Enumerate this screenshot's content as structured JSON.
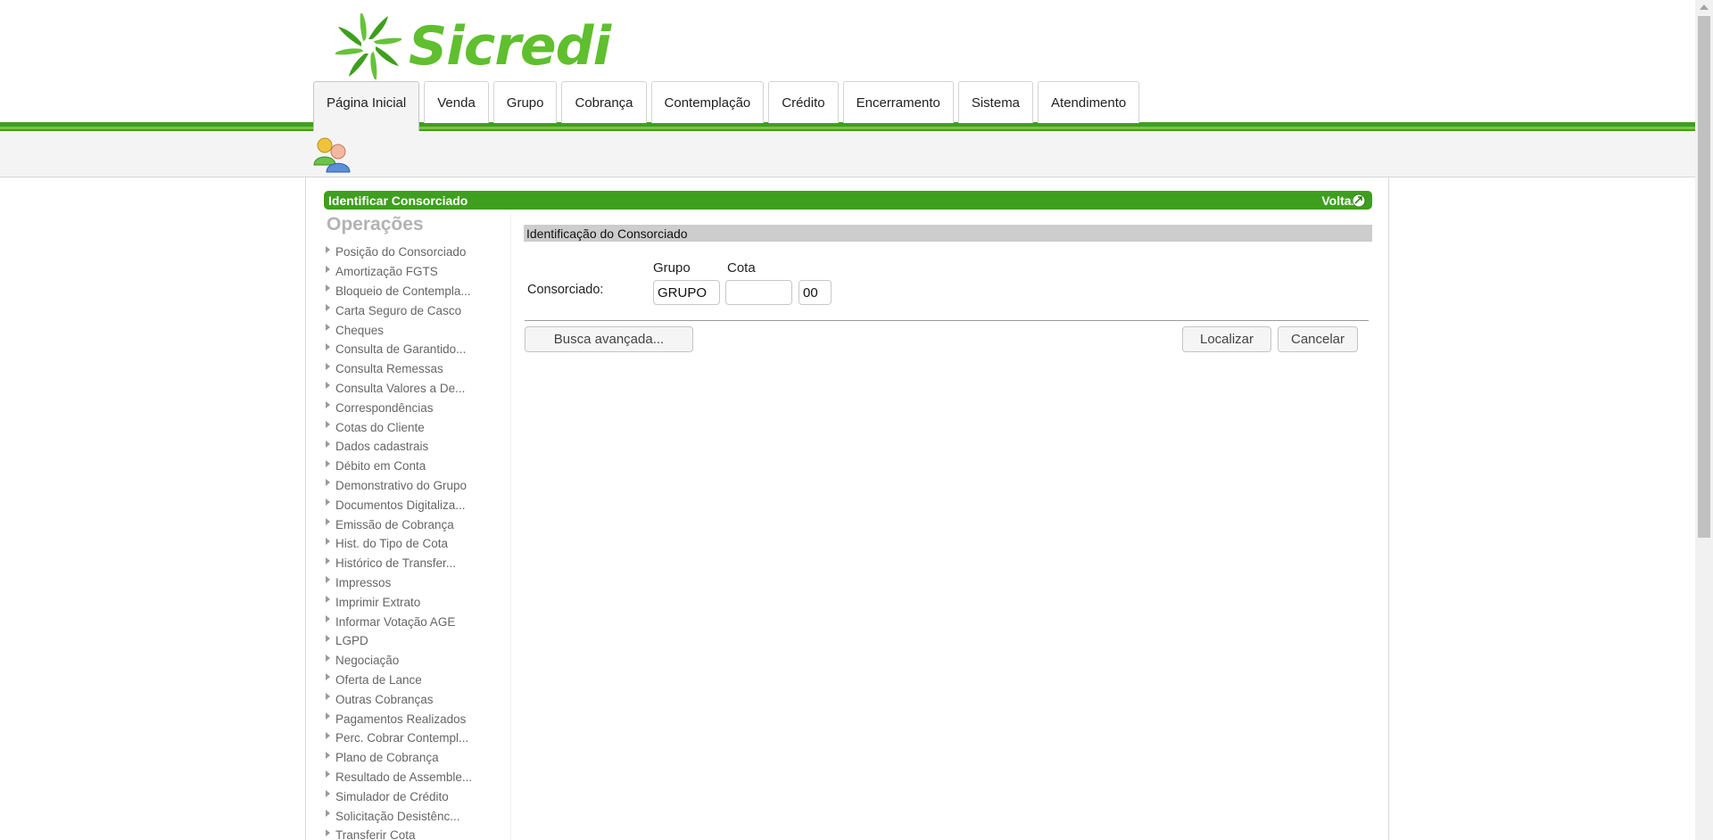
{
  "brand": {
    "name": "Sicredi",
    "color": "#5fbf2e",
    "accent": "#3e9f1e"
  },
  "nav": {
    "tabs": [
      {
        "label": "Página Inicial",
        "active": true
      },
      {
        "label": "Venda"
      },
      {
        "label": "Grupo"
      },
      {
        "label": "Cobrança"
      },
      {
        "label": "Contemplação"
      },
      {
        "label": "Crédito"
      },
      {
        "label": "Encerramento"
      },
      {
        "label": "Sistema"
      },
      {
        "label": "Atendimento"
      }
    ]
  },
  "titlebar": {
    "title": "Identificar Consorciado",
    "back_label": "Voltar",
    "back_icon": "back-arrow-icon"
  },
  "sidebar": {
    "title": "Operações",
    "items": [
      "Posição do Consorciado",
      "Amortização FGTS",
      "Bloqueio de Contempla...",
      "Carta Seguro de Casco",
      "Cheques",
      "Consulta de Garantido...",
      "Consulta Remessas",
      "Consulta Valores a De...",
      "Correspondências",
      "Cotas do Cliente",
      "Dados cadastrais",
      "Débito em Conta",
      "Demonstrativo do Grupo",
      "Documentos Digitaliza...",
      "Emissão de Cobrança",
      "Hist. do Tipo de Cota",
      "Histórico de Transfer...",
      "Impressos",
      "Imprimir Extrato",
      "Informar Votação AGE",
      "LGPD",
      "Negociação",
      "Oferta de Lance",
      "Outras Cobranças",
      "Pagamentos Realizados",
      "Perc. Cobrar Contempl...",
      "Plano de Cobrança",
      "Resultado de Assemble...",
      "Simulador de Crédito",
      "Solicitação Desistênc...",
      "Transferir Cota"
    ]
  },
  "form": {
    "section_title": "Identificação do Consorciado",
    "col_grupo": "Grupo",
    "col_cota": "Cota",
    "field_label": "Consorciado:",
    "grupo_value": "GRUPO",
    "cota_value": "",
    "digito_value": "00",
    "advanced_search_label": "Busca avançada...",
    "find_label": "Localizar",
    "cancel_label": "Cancelar"
  }
}
